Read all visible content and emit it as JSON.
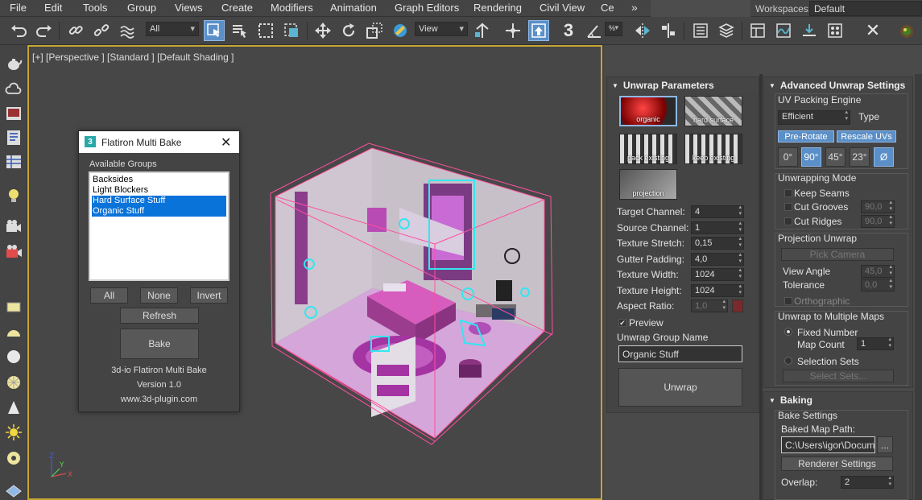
{
  "menu": {
    "items": [
      "File",
      "Edit",
      "Tools",
      "Group",
      "Views",
      "Create",
      "Modifiers",
      "Animation",
      "Graph Editors",
      "Rendering",
      "Civil View",
      "Ce"
    ],
    "overflow": "»",
    "workspaces_label": "Workspaces:",
    "workspaces_value": "Default"
  },
  "toolbar": {
    "filter_value": "All",
    "ref_coord_value": "View",
    "snap_label": "3",
    "spinner_snap_symbol": "%"
  },
  "viewport": {
    "label": "[+] [Perspective ] [Standard ] [Default Shading ]",
    "axis_x": "X",
    "axis_y": "Y",
    "axis_z": "Z"
  },
  "dialog": {
    "title": "Flatiron Multi Bake",
    "logo_text": "3",
    "close": "✕",
    "groups_label": "Available Groups",
    "groups": [
      {
        "name": "Backsides",
        "selected": false
      },
      {
        "name": "Light Blockers",
        "selected": false
      },
      {
        "name": "Hard Surface Stuff",
        "selected": true
      },
      {
        "name": "Organic Stuff",
        "selected": true
      }
    ],
    "btn_all": "All",
    "btn_none": "None",
    "btn_invert": "Invert",
    "btn_refresh": "Refresh",
    "btn_bake": "Bake",
    "product": "3d-io Flatiron Multi Bake",
    "version": "Version 1.0",
    "website": "www.3d-plugin.com"
  },
  "unwrap_params": {
    "header": "Unwrap Parameters",
    "presets": [
      "organic",
      "hard surface",
      "pack existing",
      "keep existing",
      "projection"
    ],
    "target_channel_label": "Target Channel:",
    "target_channel": "4",
    "source_channel_label": "Source Channel:",
    "source_channel": "1",
    "texture_stretch_label": "Texture Stretch:",
    "texture_stretch": "0,15",
    "gutter_padding_label": "Gutter Padding:",
    "gutter_padding": "4,0",
    "texture_width_label": "Texture Width:",
    "texture_width": "1024",
    "texture_height_label": "Texture Height:",
    "texture_height": "1024",
    "aspect_ratio_label": "Aspect Ratio:",
    "aspect_ratio": "1,0",
    "preview_label": "Preview",
    "preview_checked": true,
    "group_name_label": "Unwrap Group Name",
    "group_name_value": "Organic Stuff",
    "unwrap_button": "Unwrap"
  },
  "advanced": {
    "header": "Advanced Unwrap Settings",
    "packing_engine_label": "UV Packing Engine",
    "packing_engine_value": "Efficient",
    "type_label": "Type",
    "pre_rotate": "Pre-Rotate",
    "rescale_uvs": "Rescale UVs",
    "angles": [
      "0°",
      "90°",
      "45°",
      "23°",
      "Ø"
    ],
    "unwrapping_mode_label": "Unwrapping Mode",
    "keep_seams": "Keep Seams",
    "cut_grooves": "Cut Grooves",
    "cut_grooves_value": "90,0",
    "cut_ridges": "Cut Ridges",
    "cut_ridges_value": "90,0",
    "projection_unwrap_label": "Projection Unwrap",
    "pick_camera": "Pick Camera",
    "view_angle_label": "View Angle",
    "view_angle_value": "45,0",
    "tolerance_label": "Tolerance",
    "tolerance_value": "0,0",
    "orthographic": "Orthographic",
    "multi_maps_label": "Unwrap to Multiple Maps",
    "fixed_number": "Fixed Number",
    "map_count_label": "Map Count",
    "map_count_value": "1",
    "selection_sets": "Selection Sets",
    "select_sets_btn": "Select Sets..."
  },
  "baking": {
    "header": "Baking",
    "settings_label": "Bake Settings",
    "map_path_label": "Baked Map Path:",
    "map_path_value": "C:\\Users\\igor\\Documents",
    "browse_btn": "...",
    "renderer_settings": "Renderer Settings",
    "overlap_label": "Overlap:",
    "overlap_value": "2"
  },
  "colors": {
    "accent": "#5b8fc7",
    "viewport_border": "#c6a533",
    "selection": "#0a73d9",
    "bbox_pink": "#ff4fa0",
    "room_magenta": "#b94bb5",
    "room_cyan": "#33e6f0"
  }
}
